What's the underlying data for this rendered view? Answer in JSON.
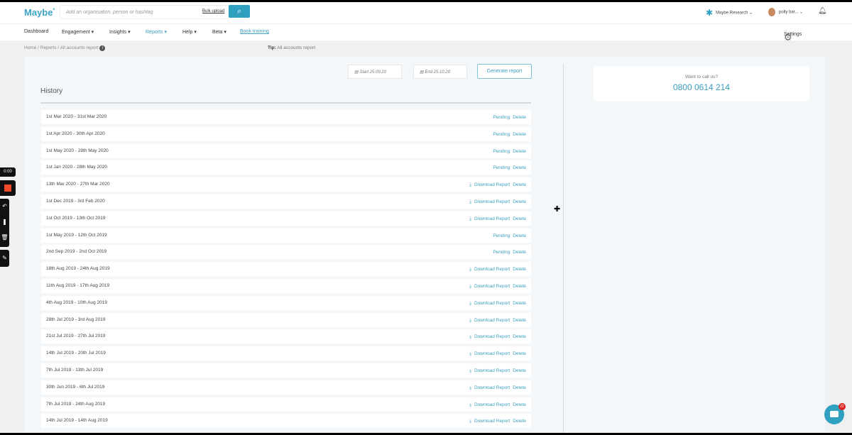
{
  "header": {
    "logo": "Maybe",
    "logo_mark": "*",
    "search_placeholder": "Add an organisation, person or hashtag",
    "bulk_upload": "Bulk upload",
    "org": "Maybe Research",
    "user": "polly bar..."
  },
  "nav": {
    "items": [
      "Dashboard",
      "Engagement ▾",
      "Insights ▾",
      "Reports ▾",
      "Help ▾",
      "Beta ▾",
      "Book training"
    ],
    "settings": "Settings"
  },
  "breadcrumb": {
    "home": "Home",
    "reports": "Reports",
    "current": "All accounts report"
  },
  "tip": {
    "label": "Tip:",
    "text": "All accounts report"
  },
  "form": {
    "start": "Start 25.09.20",
    "end": "End 25.10.20",
    "generate": "Generate report"
  },
  "history": {
    "title": "History",
    "pending": "Pending",
    "download": "Download Report",
    "delete": "Delete",
    "rows": [
      {
        "range": "1st Mar 2020 - 31st Mar 2020",
        "status": "pending"
      },
      {
        "range": "1st Apr 2020 - 30th Apr 2020",
        "status": "pending"
      },
      {
        "range": "1st May 2020 - 28th May 2020",
        "status": "pending"
      },
      {
        "range": "1st Jan 2020 - 28th May 2020",
        "status": "pending"
      },
      {
        "range": "13th Mar 2020 - 27th Mar 2020",
        "status": "download"
      },
      {
        "range": "1st Dec 2019 - 3rd Feb 2020",
        "status": "download"
      },
      {
        "range": "1st Oct 2019 - 13th Oct 2019",
        "status": "download"
      },
      {
        "range": "1st May 2019 - 12th Oct 2019",
        "status": "pending"
      },
      {
        "range": "2nd Sep 2019 - 2nd Oct 2019",
        "status": "pending"
      },
      {
        "range": "18th Aug 2019 - 24th Aug 2019",
        "status": "download"
      },
      {
        "range": "11th Aug 2019 - 17th Aug 2019",
        "status": "download"
      },
      {
        "range": "4th Aug 2019 - 10th Aug 2019",
        "status": "download"
      },
      {
        "range": "28th Jul 2019 - 3rd Aug 2019",
        "status": "download"
      },
      {
        "range": "21st Jul 2019 - 27th Jul 2019",
        "status": "download"
      },
      {
        "range": "14th Jul 2019 - 20th Jul 2019",
        "status": "download"
      },
      {
        "range": "7th Jul 2019 - 13th Jul 2019",
        "status": "download"
      },
      {
        "range": "30th Jun 2019 - 6th Jul 2019",
        "status": "download"
      },
      {
        "range": "7th Jul 2019 - 24th Aug 2019",
        "status": "download"
      },
      {
        "range": "14th Jul 2019 - 14th Aug 2019",
        "status": "download"
      }
    ]
  },
  "contact": {
    "question": "Want to call us?",
    "phone": "0800 0614 214"
  },
  "recorder": {
    "time": "0:00"
  },
  "chat": {
    "badge": "22"
  }
}
